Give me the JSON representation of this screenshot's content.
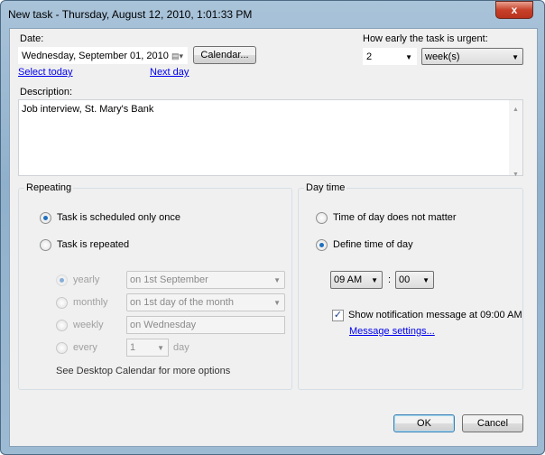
{
  "window": {
    "title": "New task - Thursday, August 12, 2010, 1:01:33 PM",
    "close_icon": "close-icon"
  },
  "date": {
    "label": "Date:",
    "value": "Wednesday, September 01, 2010",
    "calendar_button": "Calendar...",
    "select_today": "Select today",
    "next_day": "Next day"
  },
  "urgency": {
    "label": "How early the task is urgent:",
    "amount": "2",
    "unit": "week(s)"
  },
  "description": {
    "label": "Description:",
    "value": "Job interview, St. Mary's Bank"
  },
  "repeating": {
    "title": "Repeating",
    "once": "Task is scheduled only once",
    "repeated": "Task is repeated",
    "selected": "once",
    "options": [
      {
        "label": "yearly",
        "value": "on 1st September"
      },
      {
        "label": "monthly",
        "value": "on 1st day of the month"
      },
      {
        "label": "weekly",
        "value": "on Wednesday"
      },
      {
        "label": "every",
        "value": "1",
        "suffix": "day"
      }
    ],
    "more": "See Desktop Calendar for more options"
  },
  "daytime": {
    "title": "Day time",
    "no_matter": "Time of day does not matter",
    "define": "Define time of day",
    "selected": "define",
    "hour": "09 AM",
    "separator": ":",
    "minute": "00",
    "notify_checked": true,
    "notify_label": "Show notification message at 09:00 AM",
    "message_settings": "Message settings..."
  },
  "buttons": {
    "ok": "OK",
    "cancel": "Cancel"
  }
}
